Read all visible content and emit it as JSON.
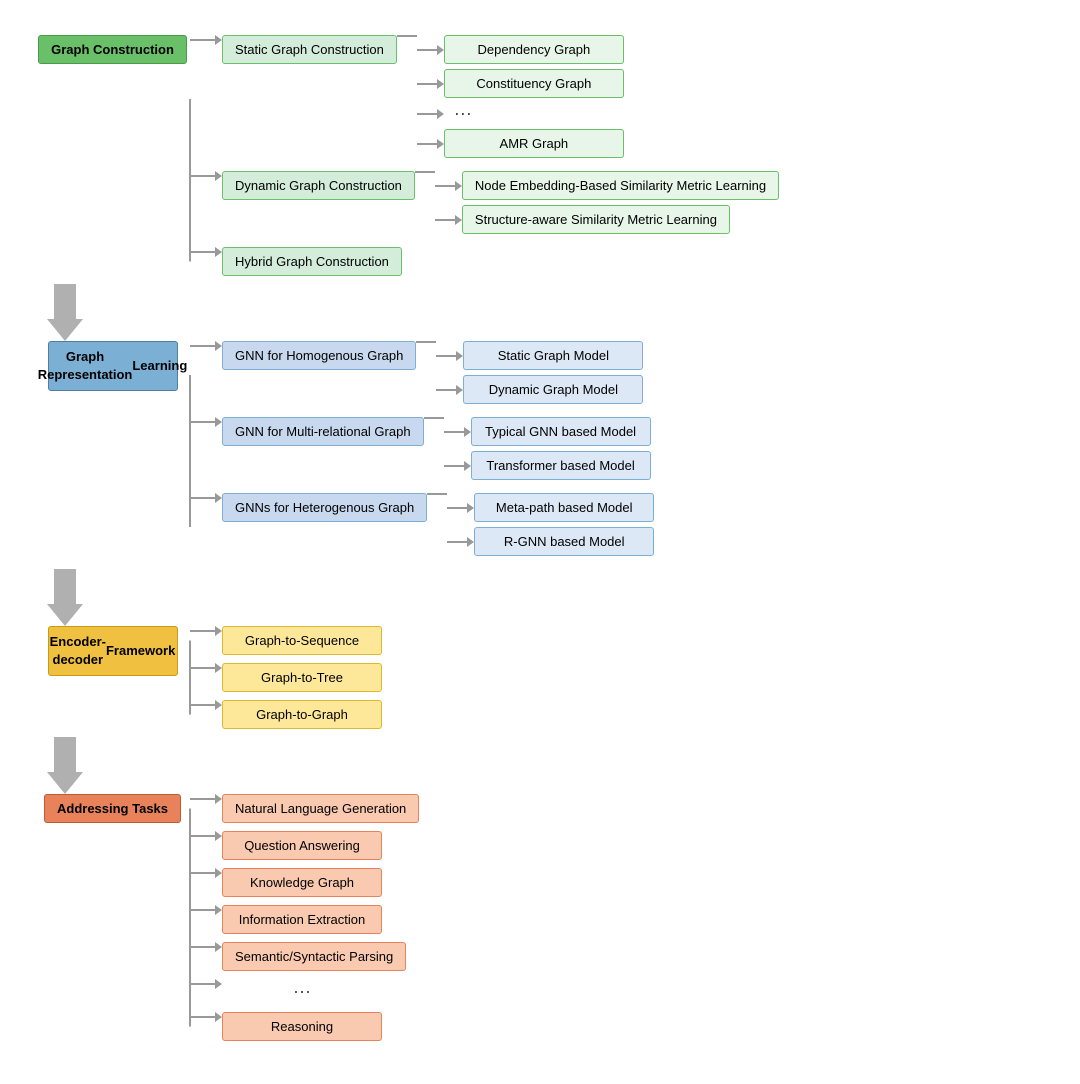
{
  "phases": [
    {
      "id": "graph-construction",
      "label": "Graph Construction",
      "label_line2": "",
      "color": "green-main",
      "branches": [
        {
          "label": "Static Graph Construction",
          "color": "green-sub",
          "leaves": [
            {
              "label": "Dependency Graph",
              "color": "green-leaf"
            },
            {
              "label": "Constituency Graph",
              "color": "green-leaf"
            },
            {
              "label": "...",
              "color": "dots"
            },
            {
              "label": "AMR Graph",
              "color": "green-leaf"
            }
          ]
        },
        {
          "label": "Dynamic Graph Construction",
          "color": "green-sub",
          "leaves": [
            {
              "label": "Node Embedding-Based Similarity Metric Learning",
              "color": "green-leaf"
            },
            {
              "label": "Structure-aware Similarity Metric Learning",
              "color": "green-leaf"
            }
          ]
        },
        {
          "label": "Hybrid Graph Construction",
          "color": "green-sub",
          "leaves": []
        }
      ]
    },
    {
      "id": "graph-representation",
      "label": "Graph Representation",
      "label_line2": "Learning",
      "color": "blue-main",
      "branches": [
        {
          "label": "GNN for Homogenous Graph",
          "color": "blue-sub",
          "leaves": [
            {
              "label": "Static Graph Model",
              "color": "blue-leaf"
            },
            {
              "label": "Dynamic Graph Model",
              "color": "blue-leaf"
            }
          ]
        },
        {
          "label": "GNN for Multi-relational Graph",
          "color": "blue-sub",
          "leaves": [
            {
              "label": "Typical GNN based Model",
              "color": "blue-leaf"
            },
            {
              "label": "Transformer based Model",
              "color": "blue-leaf"
            }
          ]
        },
        {
          "label": "GNNs for Heterogenous Graph",
          "color": "blue-sub",
          "leaves": [
            {
              "label": "Meta-path based Model",
              "color": "blue-leaf"
            },
            {
              "label": "R-GNN based Model",
              "color": "blue-leaf"
            }
          ]
        }
      ]
    },
    {
      "id": "encoder-decoder",
      "label": "Encoder-decoder",
      "label_line2": "Framework",
      "color": "yellow-main",
      "branches": [
        {
          "label": "Graph-to-Sequence",
          "color": "yellow-sub",
          "leaves": []
        },
        {
          "label": "Graph-to-Tree",
          "color": "yellow-sub",
          "leaves": []
        },
        {
          "label": "Graph-to-Graph",
          "color": "yellow-sub",
          "leaves": []
        }
      ]
    },
    {
      "id": "addressing-tasks",
      "label": "Addressing Tasks",
      "label_line2": "",
      "color": "orange-main",
      "branches": [
        {
          "label": "Natural Language Generation",
          "color": "orange-sub",
          "leaves": []
        },
        {
          "label": "Question Answering",
          "color": "orange-sub",
          "leaves": []
        },
        {
          "label": "Knowledge Graph",
          "color": "orange-sub",
          "leaves": []
        },
        {
          "label": "Information Extraction",
          "color": "orange-sub",
          "leaves": []
        },
        {
          "label": "Semantic/Syntactic Parsing",
          "color": "orange-sub",
          "leaves": []
        },
        {
          "label": "...",
          "color": "dots",
          "leaves": []
        },
        {
          "label": "Reasoning",
          "color": "orange-sub",
          "leaves": []
        }
      ]
    }
  ]
}
